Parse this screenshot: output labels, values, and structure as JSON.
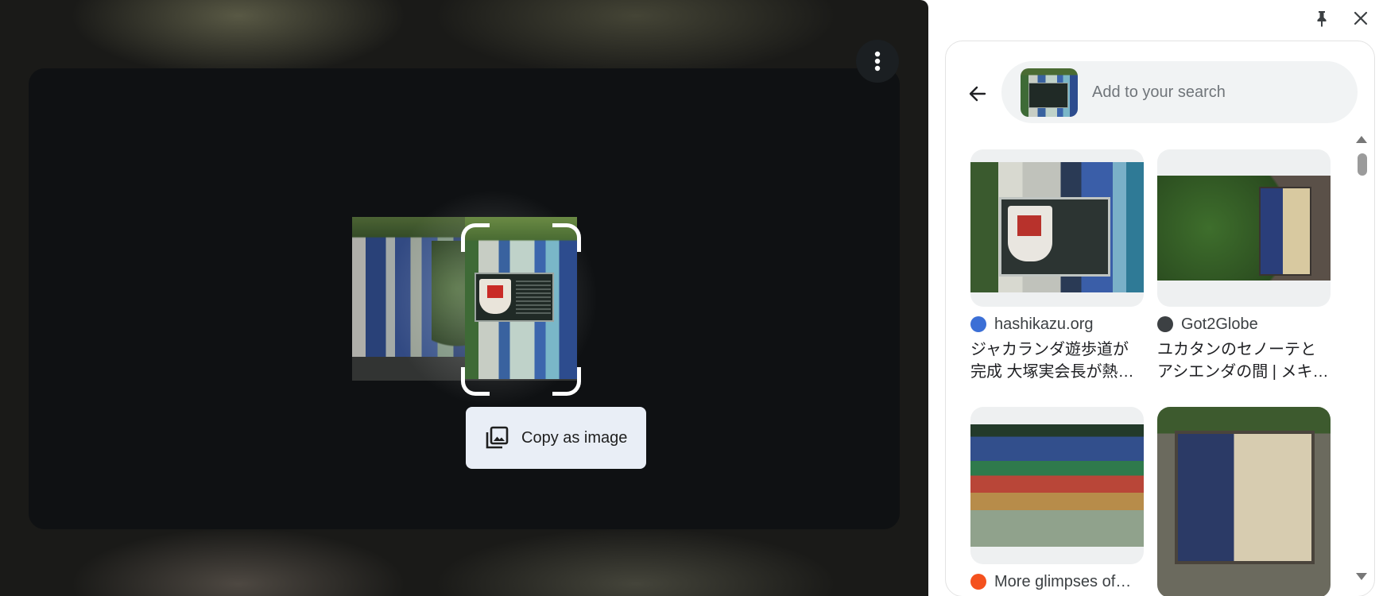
{
  "overlay": {
    "copy_button_label": "Copy as image",
    "icons": {
      "more": "more-vert-icon",
      "copy": "copy-image-icon"
    }
  },
  "side_panel": {
    "icons": {
      "pin": "pin-icon",
      "close": "close-icon",
      "back": "arrow-back-icon"
    },
    "search": {
      "placeholder": "Add to your search",
      "value": ""
    },
    "results": [
      {
        "source": "hashikazu.org",
        "favicon_color": "#3b6fd6",
        "title": "ジャカランダ遊歩道が完成 大塚実会長が熱心に取り組む"
      },
      {
        "source": "Got2Globe",
        "favicon_color": "#3c4043",
        "title": "ユカタンのセノーテとアシエンダの間 | メキシコ"
      },
      {
        "source": "More glimpses of…",
        "favicon_color": "#f4511e",
        "title": ""
      },
      {
        "source": "",
        "favicon_color": "",
        "title": ""
      }
    ]
  },
  "colors": {
    "overlay_background": "#0f1113",
    "copy_button_background": "#e9eef6",
    "search_background": "#f1f3f4"
  }
}
